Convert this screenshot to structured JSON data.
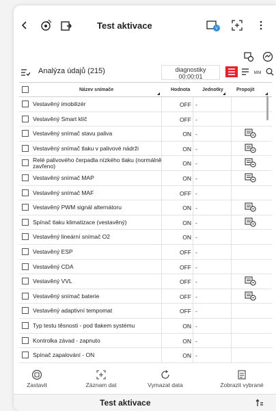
{
  "header": {
    "title": "Test aktivace"
  },
  "list_header": {
    "title": "Analýza údajů (215)",
    "diag_line1": "diagnostiky",
    "diag_line2": "00:00:01",
    "view_text_icon": "ᴍᴍ"
  },
  "table": {
    "columns": {
      "name": "Název snímače",
      "value": "Hodnota",
      "unit": "Jednotky",
      "link": "Propojit"
    },
    "rows": [
      {
        "name": "Vestavěný imobilizér",
        "value": "OFF",
        "unit": "-",
        "link": false
      },
      {
        "name": "Vestavěný Smart klíč",
        "value": "OFF",
        "unit": "-",
        "link": false
      },
      {
        "name": "Vestavěný snímač stavu paliva",
        "value": "ON",
        "unit": "-",
        "link": true
      },
      {
        "name": "Vestavěný snímač tlaku v palivové nádrži",
        "value": "ON",
        "unit": "-",
        "link": true
      },
      {
        "name": "Relé palivového čerpadla nízkého tlaku (normálně zavřeno)",
        "value": "ON",
        "unit": "-",
        "link": true
      },
      {
        "name": "Vestavěný snímač MAP",
        "value": "ON",
        "unit": "-",
        "link": true
      },
      {
        "name": "Vestavěný snímač MAF",
        "value": "OFF",
        "unit": "-",
        "link": false
      },
      {
        "name": "Vestavěný PWM signál alternátoru",
        "value": "ON",
        "unit": "-",
        "link": true
      },
      {
        "name": "Spínač tlaku klimatizace (vestavěný)",
        "value": "ON",
        "unit": "-",
        "link": true
      },
      {
        "name": "Vestavěný lineární snímač O2",
        "value": "ON",
        "unit": "-",
        "link": false
      },
      {
        "name": "Vestavěný ESP",
        "value": "OFF",
        "unit": "-",
        "link": false
      },
      {
        "name": "Vestavěný CDA",
        "value": "OFF",
        "unit": "-",
        "link": false
      },
      {
        "name": "Vestavěný VVL",
        "value": "OFF",
        "unit": "-",
        "link": true
      },
      {
        "name": "Vestavěný snímač baterie",
        "value": "OFF",
        "unit": "-",
        "link": true
      },
      {
        "name": "Vestavěný adaptivní tempomat",
        "value": "OFF",
        "unit": "-",
        "link": false
      },
      {
        "name": "Typ testu těsnosti - pod tlakem systému",
        "value": "ON",
        "unit": "-",
        "link": false
      },
      {
        "name": "Kontrolka závad - zapnuto",
        "value": "ON",
        "unit": "-",
        "link": false
      },
      {
        "name": "Spínač zapalování - ON",
        "value": "ON",
        "unit": "-",
        "link": false
      }
    ]
  },
  "bottom": {
    "stop": "Zastavit",
    "record": "Záznam dat",
    "clear": "Vymazat data",
    "show": "Zobrazit vybrané"
  },
  "footer": {
    "title": "Test aktivace"
  },
  "colors": {
    "accent": "#e8202a"
  }
}
